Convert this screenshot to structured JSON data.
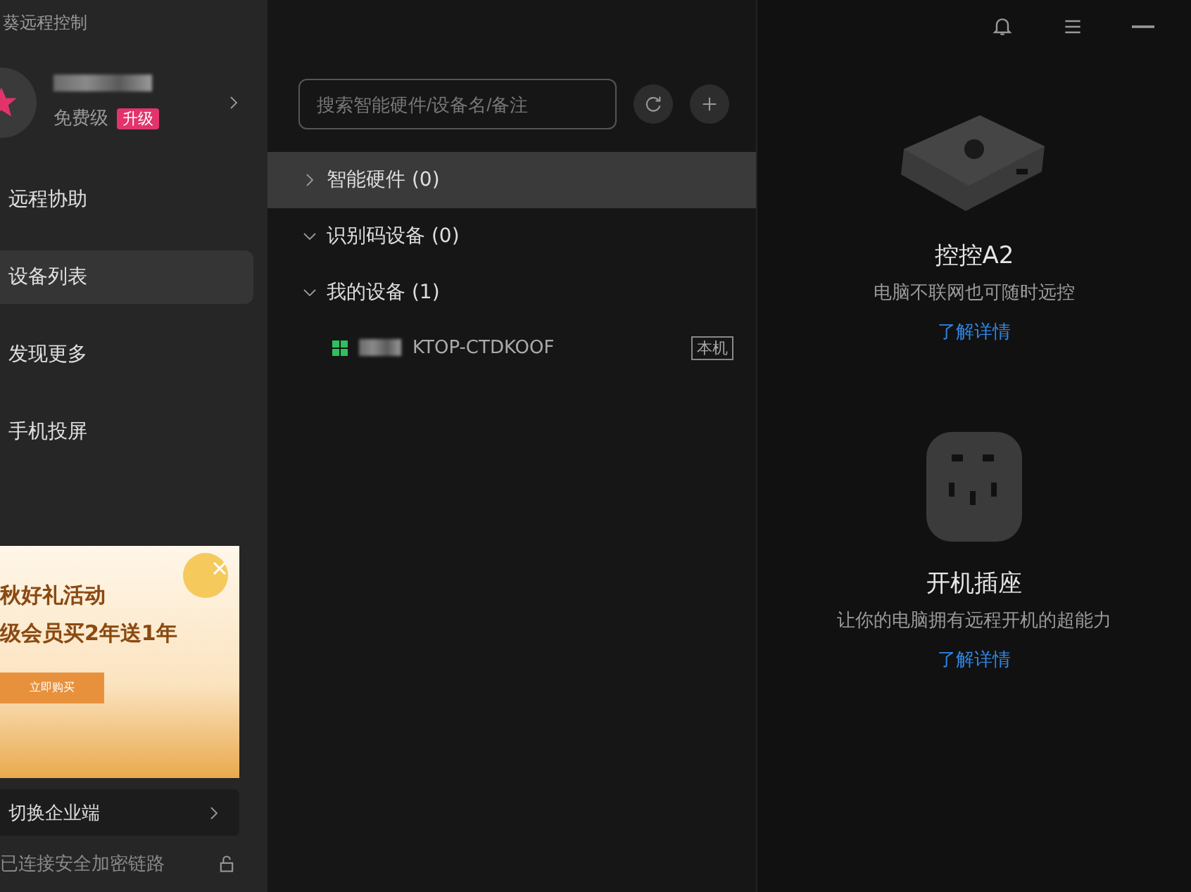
{
  "window": {
    "title": "葵远程控制"
  },
  "user": {
    "plan": "免费级",
    "upgrade": "升级"
  },
  "nav": [
    {
      "label": "远程协助",
      "selected": false
    },
    {
      "label": "设备列表",
      "selected": true
    },
    {
      "label": "发现更多",
      "selected": false
    },
    {
      "label": "手机投屏",
      "selected": false
    }
  ],
  "banner": {
    "line_1": "秋好礼活动",
    "line_2": "级会员买2年送1年",
    "button": "立即购买"
  },
  "switch_enterprise": "切换企业端",
  "status_bar": "已连接安全加密链路",
  "search": {
    "placeholder": "搜索智能硬件/设备名/备注"
  },
  "groups": [
    {
      "label": "智能硬件 (0)",
      "expanded": false,
      "selected": true
    },
    {
      "label": "识别码设备 (0)",
      "expanded": true,
      "selected": false
    },
    {
      "label": "我的设备 (1)",
      "expanded": true,
      "selected": false,
      "devices": [
        {
          "name": "KTOP-CTDKOOF",
          "tag": "本机"
        }
      ]
    }
  ],
  "products": [
    {
      "kind": "box",
      "name": "控控A2",
      "desc": "电脑不联网也可随时远控",
      "link": "了解详情"
    },
    {
      "kind": "plug",
      "name": "开机插座",
      "desc": "让你的电脑拥有远程开机的超能力",
      "link": "了解详情"
    }
  ]
}
